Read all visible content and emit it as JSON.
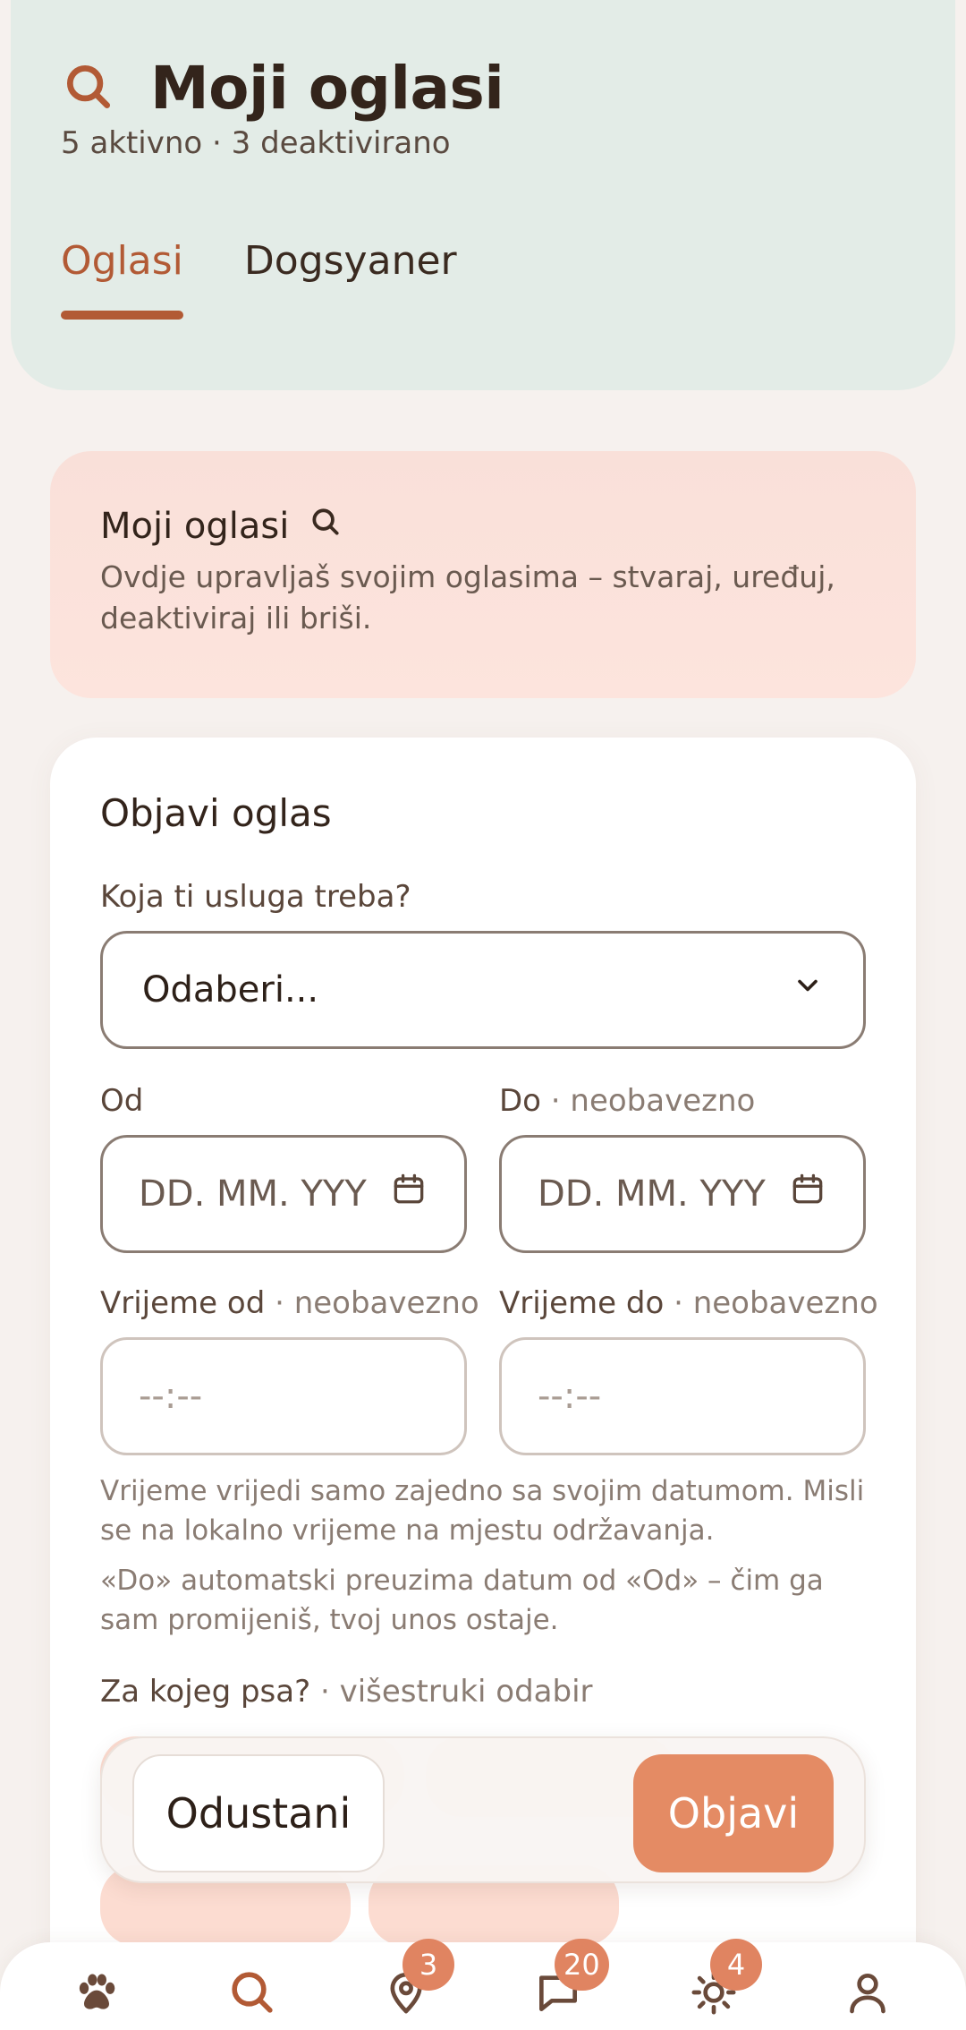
{
  "header": {
    "title": "Moji oglasi",
    "subtitle": "5 aktivno · 3 deaktivirano",
    "tabs": [
      {
        "label": "Oglasi",
        "active": true
      },
      {
        "label": "Dogsyaner",
        "active": false
      }
    ]
  },
  "info": {
    "title": "Moji oglasi",
    "text": "Ovdje upravljaš svojim oglasima – stvaraj, uređuj, deaktiviraj ili briši."
  },
  "form": {
    "title": "Objavi oglas",
    "service_label": "Koja ti usluga treba?",
    "service_value": "Odaberi...",
    "from_label": "Od",
    "to_label": "Do",
    "optional": "· neobavezno",
    "date_placeholder": "DD. MM. YYY",
    "time_from_label": "Vrijeme od",
    "time_to_label": "Vrijeme do",
    "time_placeholder": "--:--",
    "hint1": "Vrijeme vrijedi samo zajedno sa svojim datumom. Misli se na lokalno vrijeme na mjestu održavanja.",
    "hint2": "«Do» automatski preuzima datum od «Od» – čim ga sam promijeniš, tvoj unos ostaje.",
    "dog_label": "Za kojeg psa?",
    "dog_label_suffix": "· višestruki odabir"
  },
  "actions": {
    "cancel": "Odustani",
    "publish": "Objavi"
  },
  "nav": {
    "items": [
      {
        "icon": "paw-icon"
      },
      {
        "icon": "search-icon"
      },
      {
        "icon": "map-pin-icon",
        "badge": "3"
      },
      {
        "icon": "chat-icon",
        "badge": "20"
      },
      {
        "icon": "sun-icon",
        "badge": "4"
      },
      {
        "icon": "user-icon"
      }
    ]
  },
  "colors": {
    "accent": "#b25a35",
    "publish": "#e48b64",
    "badge": "#e08461",
    "header_bg": "#e3ece7"
  }
}
